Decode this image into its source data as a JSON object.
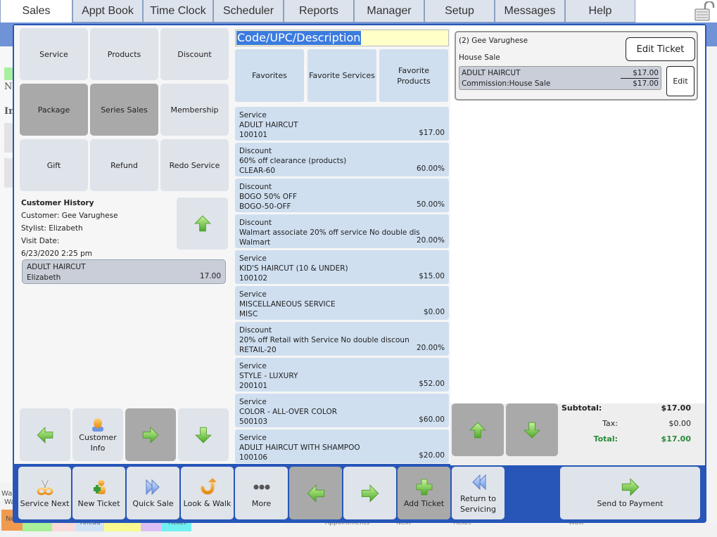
{
  "nav": {
    "tabs": [
      {
        "label": "Sales",
        "active": true
      },
      {
        "label": "Appt Book"
      },
      {
        "label": "Time Clock"
      },
      {
        "label": "Scheduler"
      },
      {
        "label": "Reports"
      },
      {
        "label": "Manager"
      },
      {
        "label": "Setup"
      },
      {
        "label": "Messages"
      },
      {
        "label": "Help"
      }
    ],
    "lock_icon": "padlock-open-icon"
  },
  "background": {
    "left_text_1": "Ne",
    "left_text_2": "In",
    "bottom_left_1": "Wa",
    "bottom_left_2": "Wa",
    "legend_first": "Ne",
    "legend_ahead": "Ahead",
    "legend_ticket": "Ticket",
    "bottom_appointments": "Appointments",
    "bottom_next": "Next",
    "bottom_ticket": "Ticket",
    "bottom_walk": "Walk"
  },
  "categories": [
    {
      "label": "Service"
    },
    {
      "label": "Products"
    },
    {
      "label": "Discount"
    },
    {
      "label": "Package",
      "dark": true
    },
    {
      "label": "Series Sales",
      "dark": true
    },
    {
      "label": "Membership"
    },
    {
      "label": "Gift"
    },
    {
      "label": "Refund"
    },
    {
      "label": "Redo Service"
    }
  ],
  "customer_history": {
    "title": "Customer History",
    "customer": "Customer: Gee Varughese",
    "stylist": "Stylist: Elizabeth",
    "visit_date_label": "Visit Date:",
    "visit_date": "6/23/2020 2:25 pm",
    "item": {
      "name": "ADULT HAIRCUT",
      "stylist": "Elizabeth",
      "amount": "17.00"
    }
  },
  "left_nav": {
    "customer_info_label_1": "Customer",
    "customer_info_label_2": "Info"
  },
  "search": {
    "placeholder": "Code/UPC/Description"
  },
  "favorites": [
    {
      "label": "Favorites"
    },
    {
      "label": "Favorite Services"
    },
    {
      "label": "Favorite Products"
    }
  ],
  "items": [
    {
      "type": "Service",
      "name": "ADULT HAIRCUT",
      "code": "100101",
      "price": "$17.00"
    },
    {
      "type": "Discount",
      "name": "60% off clearance (products)",
      "code": "CLEAR-60",
      "price": "60.00%"
    },
    {
      "type": "Discount",
      "name": "BOGO 50% OFF",
      "code": "BOGO-50-OFF",
      "price": "50.00%"
    },
    {
      "type": "Discount",
      "name": "Walmart associate 20% off service No double dis",
      "code": "Walmart",
      "price": "20.00%"
    },
    {
      "type": "Service",
      "name": "KID'S HAIRCUT (10 & UNDER)",
      "code": "100102",
      "price": "$15.00"
    },
    {
      "type": "Service",
      "name": "MISCELLANEOUS SERVICE",
      "code": "MISC",
      "price": "$0.00"
    },
    {
      "type": "Discount",
      "name": "20% off Retail with Service No double discoun",
      "code": "RETAIL-20",
      "price": "20.00%"
    },
    {
      "type": "Service",
      "name": "STYLE - LUXURY",
      "code": "200101",
      "price": "$52.00"
    },
    {
      "type": "Service",
      "name": "COLOR - ALL-OVER COLOR",
      "code": "500103",
      "price": "$60.00"
    },
    {
      "type": "Service",
      "name": "ADULT HAIRCUT WITH SHAMPOO",
      "code": "100106",
      "price": "$20.00"
    }
  ],
  "ticket": {
    "customer": "(2) Gee Varughese",
    "type": "House Sale",
    "edit_ticket_label": "Edit Ticket",
    "line": {
      "name": "ADULT HAIRCUT",
      "price": "$17.00",
      "commission": "Commission:House Sale",
      "commission_amount": "$17.00"
    },
    "edit_label": "Edit"
  },
  "totals": {
    "subtotal_label": "Subtotal:",
    "subtotal": "$17.00",
    "tax_label": "Tax:",
    "tax": "$0.00",
    "total_label": "Total:",
    "total": "$17.00",
    "total_color": "#2a8a3a"
  },
  "toolbar": {
    "service_next": "Service Next",
    "new_ticket": "New Ticket",
    "quick_sale": "Quick Sale",
    "look_walk": "Look & Walk",
    "more": "More",
    "add_ticket": "Add Ticket",
    "return_1": "Return to",
    "return_2": "Servicing",
    "send_payment": "Send to Payment"
  },
  "colors": {
    "dialog_border": "#2756b8",
    "button_bg": "#dfe3ea",
    "button_disabled": "#a9a9a9",
    "list_item_bg": "#cfdff0",
    "search_bg": "#ffffc8",
    "selection": "#3b7be0",
    "arrow_green": "#6cc832"
  }
}
